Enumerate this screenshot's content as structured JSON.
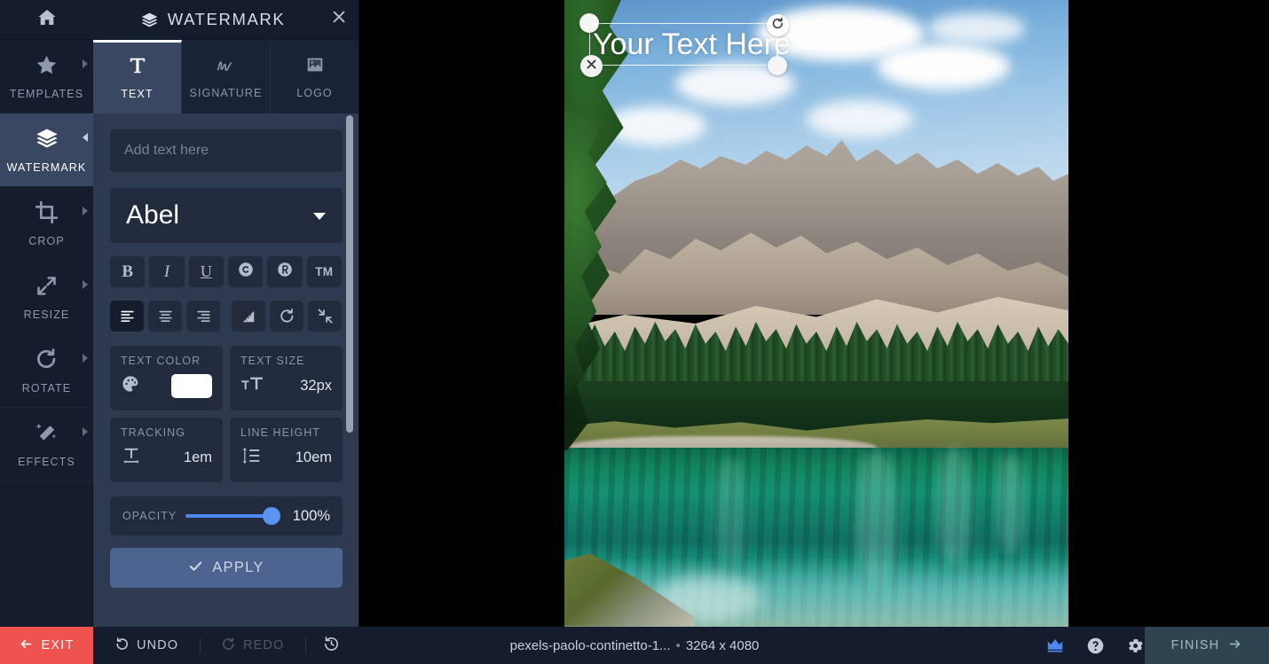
{
  "rail": {
    "home_icon": "home-icon",
    "items": [
      {
        "label": "TEMPLATES",
        "icon": "star-icon",
        "active": false,
        "arrow": "right"
      },
      {
        "label": "WATERMARK",
        "icon": "layers-icon",
        "active": true,
        "arrow": "left"
      },
      {
        "label": "CROP",
        "icon": "crop-icon",
        "active": false,
        "arrow": "right"
      },
      {
        "label": "RESIZE",
        "icon": "resize-icon",
        "active": false,
        "arrow": "right"
      },
      {
        "label": "ROTATE",
        "icon": "rotate-icon",
        "active": false,
        "arrow": "right"
      },
      {
        "label": "EFFECTS",
        "icon": "magic-wand-icon",
        "active": false,
        "arrow": "right"
      }
    ]
  },
  "panel": {
    "title": "WATERMARK",
    "title_icon": "layers-icon",
    "close_icon": "close-icon",
    "tabs": [
      {
        "label": "TEXT",
        "icon": "text-t-icon",
        "active": true
      },
      {
        "label": "SIGNATURE",
        "icon": "signature-icon",
        "active": false
      },
      {
        "label": "LOGO",
        "icon": "image-icon",
        "active": false
      }
    ],
    "text_input": {
      "value": "",
      "placeholder": "Add text here"
    },
    "font": {
      "selected": "Abel",
      "caret_icon": "chevron-down-icon"
    },
    "style_buttons": [
      {
        "name": "bold",
        "glyph": "B",
        "active": false
      },
      {
        "name": "italic",
        "glyph": "I",
        "active": false
      },
      {
        "name": "underline",
        "glyph": "U",
        "active": false
      },
      {
        "name": "copyright",
        "glyph": "©",
        "active": false
      },
      {
        "name": "registered",
        "glyph": "®",
        "active": false
      },
      {
        "name": "trademark",
        "glyph": "TM",
        "active": false
      }
    ],
    "align_buttons": [
      {
        "name": "align-left",
        "active": true
      },
      {
        "name": "align-center",
        "active": false
      },
      {
        "name": "align-right",
        "active": false
      }
    ],
    "transform_buttons": [
      {
        "name": "skew",
        "active": false
      },
      {
        "name": "rotate",
        "active": false
      },
      {
        "name": "fit-shrink",
        "active": false
      }
    ],
    "text_color": {
      "label": "TEXT COLOR",
      "value": "#ffffff",
      "icon": "palette-icon"
    },
    "text_size": {
      "label": "TEXT SIZE",
      "value": "32px",
      "icon": "font-size-icon"
    },
    "tracking": {
      "label": "TRACKING",
      "value": "1em",
      "icon": "tracking-icon"
    },
    "line_height": {
      "label": "LINE HEIGHT",
      "value": "10em",
      "icon": "line-height-icon"
    },
    "opacity": {
      "label": "OPACITY",
      "value": "100%",
      "percent": 100
    },
    "apply": {
      "label": "APPLY",
      "icon": "check-icon"
    }
  },
  "canvas": {
    "watermark_text": "Your Text Here",
    "handles": {
      "delete_icon": "close-icon",
      "rotate_icon": "rotate-cw-icon",
      "top_left": "resize-handle",
      "bottom_right": "resize-handle"
    }
  },
  "bottom": {
    "exit": {
      "label": "EXIT",
      "icon": "arrow-left-icon",
      "color": "#ef5350"
    },
    "undo": {
      "label": "UNDO",
      "icon": "undo-icon",
      "disabled": false
    },
    "redo": {
      "label": "REDO",
      "icon": "redo-icon",
      "disabled": true
    },
    "history": {
      "icon": "history-icon"
    },
    "file": {
      "name": "pexels-paolo-continetto-1...",
      "separator": "•",
      "dimensions": "3264 x 4080"
    },
    "tools": [
      {
        "name": "crown-icon",
        "color": "#4d88ee"
      },
      {
        "name": "help-circle-icon",
        "color": "#c3cad8"
      },
      {
        "name": "gear-icon",
        "color": "#c3cad8"
      }
    ],
    "finish": {
      "label": "FINISH",
      "icon": "arrow-right-icon"
    }
  }
}
